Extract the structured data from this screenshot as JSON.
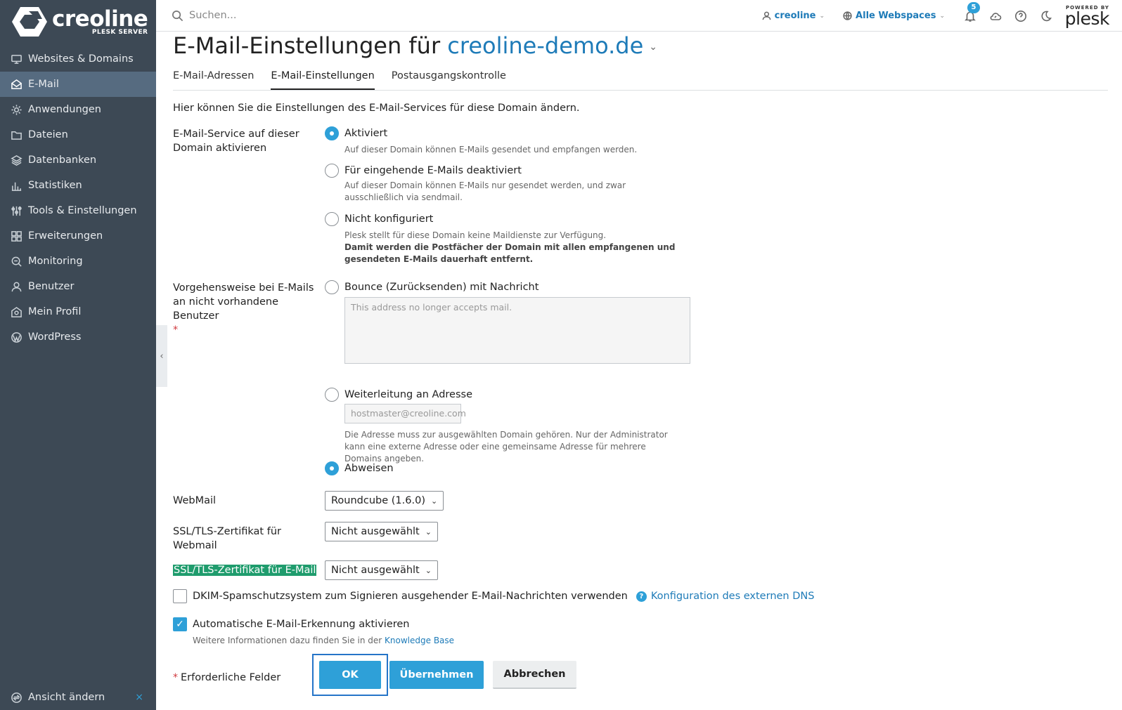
{
  "brand": {
    "name": "creoline",
    "sub": "PLESK SERVER"
  },
  "sidebar": {
    "items": [
      {
        "label": "Websites & Domains",
        "icon": "monitor-icon"
      },
      {
        "label": "E-Mail",
        "icon": "mail-icon",
        "active": true
      },
      {
        "label": "Anwendungen",
        "icon": "gear-icon"
      },
      {
        "label": "Dateien",
        "icon": "folder-icon"
      },
      {
        "label": "Datenbanken",
        "icon": "database-icon"
      },
      {
        "label": "Statistiken",
        "icon": "bar-chart-icon"
      },
      {
        "label": "Tools & Einstellungen",
        "icon": "sliders-icon"
      },
      {
        "label": "Erweiterungen",
        "icon": "grid-icon"
      },
      {
        "label": "Monitoring",
        "icon": "magnifier-icon"
      },
      {
        "label": "Benutzer",
        "icon": "user-icon"
      },
      {
        "label": "Mein Profil",
        "icon": "profile-icon"
      },
      {
        "label": "WordPress",
        "icon": "wordpress-icon"
      }
    ],
    "footer_label": "Ansicht ändern",
    "footer_close": "×"
  },
  "topbar": {
    "search_placeholder": "Suchen...",
    "user": "creoline",
    "webspaces": "Alle Webspaces",
    "notifications_count": "5",
    "powered_small": "POWERED BY",
    "powered_big": "plesk"
  },
  "page": {
    "title_prefix": "E-Mail-Einstellungen für",
    "title_domain": "creoline-demo.de",
    "tabs": [
      "E-Mail-Adressen",
      "E-Mail-Einstellungen",
      "Postausgangskontrolle"
    ],
    "intro": "Hier können Sie die Einstellungen des E-Mail-Services für diese Domain ändern."
  },
  "form": {
    "service_label": "E-Mail-Service auf dieser Domain aktivieren",
    "service_options": [
      {
        "label": "Aktiviert",
        "checked": true,
        "hint": "Auf dieser Domain können E-Mails gesendet und empfangen werden."
      },
      {
        "label": "Für eingehende E-Mails deaktiviert",
        "checked": false,
        "hint": "Auf dieser Domain können E-Mails nur gesendet werden, und zwar ausschließlich via sendmail."
      },
      {
        "label": "Nicht konfiguriert",
        "checked": false,
        "hint": "Plesk stellt für diese Domain keine Maildienste zur Verfügung.",
        "hint_bold": "Damit werden die Postfächer der Domain mit allen empfangenen und gesendeten E-Mails dauerhaft entfernt."
      }
    ],
    "nonexistent_label": "Vorgehensweise bei E-Mails an nicht vorhandene Benutzer",
    "required_mark": "*",
    "bounce_label": "Bounce (Zurücksenden) mit Nachricht",
    "bounce_text": "This address no longer accepts mail.",
    "forward_label": "Weiterleitung an Adresse",
    "forward_value": "hostmaster@creoline.com",
    "forward_hint": "Die Adresse muss zur ausgewählten Domain gehören. Nur der Administrator kann eine externe Adresse oder eine gemeinsame Adresse für mehrere Domains angeben.",
    "reject_label": "Abweisen",
    "webmail_label": "WebMail",
    "webmail_value": "Roundcube (1.6.0)",
    "ssl_webmail_label": "SSL/TLS-Zertifikat für Webmail",
    "ssl_webmail_value": "Nicht ausgewählt",
    "ssl_mail_label": "SSL/TLS-Zertifikat für E-Mail",
    "ssl_mail_value": "Nicht ausgewählt",
    "dkim_label": "DKIM-Spamschutzsystem zum Signieren ausgehender E-Mail-Nachrichten verwenden",
    "dkim_checked": false,
    "dns_link": "Konfiguration des externen DNS",
    "autodiscover_label": "Automatische E-Mail-Erkennung aktivieren",
    "autodiscover_checked": true,
    "autodiscover_hint": "Weitere Informationen dazu finden Sie in der",
    "kb_link": "Knowledge Base",
    "required_note": "Erforderliche Felder"
  },
  "buttons": {
    "ok": "OK",
    "apply": "Übernehmen",
    "cancel": "Abbrechen"
  },
  "colors": {
    "sidebar": "#3d4955",
    "accent": "#2ea0d8",
    "link": "#1e7bb8",
    "highlight": "#1f9c6d"
  }
}
